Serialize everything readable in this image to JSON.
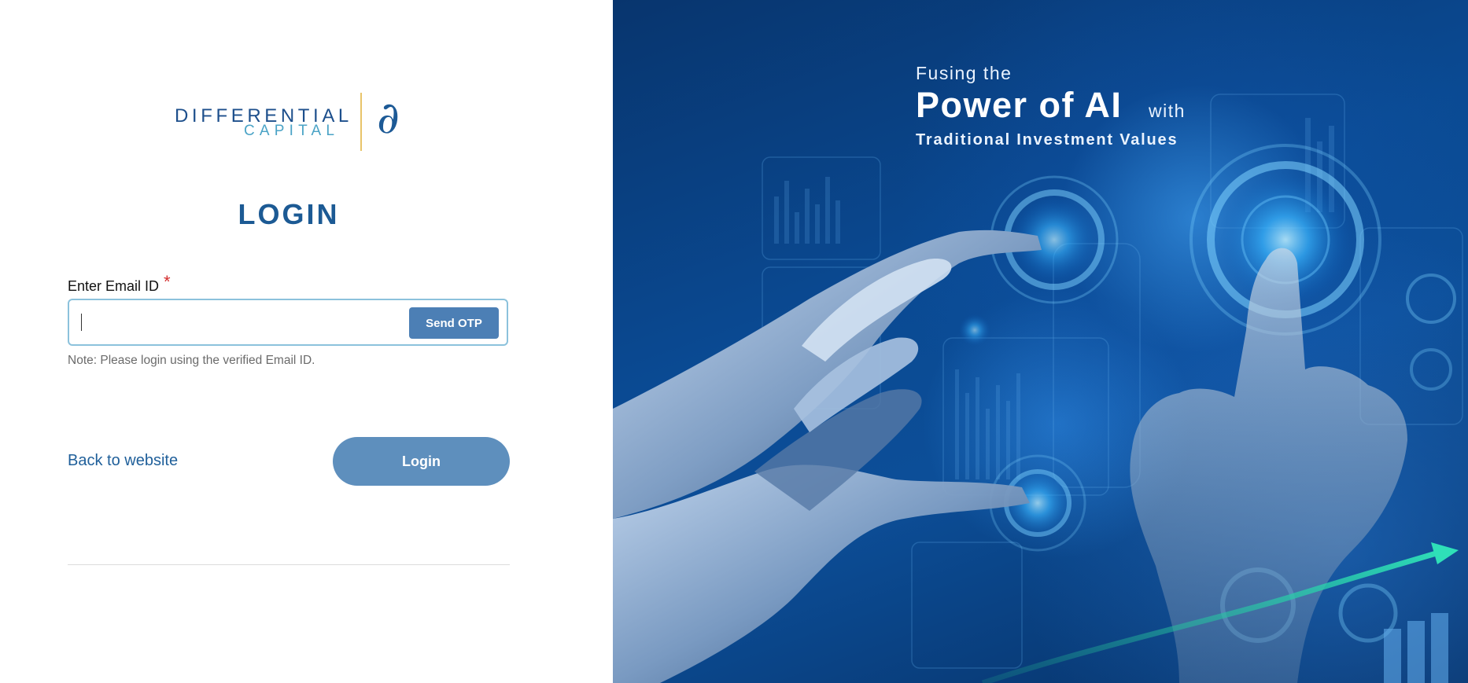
{
  "brand": {
    "name_line1": "DIFFERENTIAL",
    "name_line2": "CAPITAL",
    "mark": "∂",
    "colors": {
      "primary": "#1d4f8c",
      "secondary": "#4aa3c6",
      "gold": "#e8c46a"
    }
  },
  "login": {
    "title": "LOGIN",
    "email_label": "Enter Email ID",
    "required_marker": "*",
    "email_value": "",
    "email_placeholder": "",
    "send_otp_label": "Send OTP",
    "note": "Note: Please login using the verified Email ID.",
    "back_link_label": "Back to website",
    "login_button_label": "Login"
  },
  "hero": {
    "line1": "Fusing the",
    "line2": "Power of AI",
    "line2_suffix": "with",
    "line3": "Traditional Investment Values"
  },
  "colors": {
    "accent": "#1c5a94",
    "button": "#4c7fb5",
    "login_button": "#5e8fbd",
    "required": "#d32f2f",
    "input_border": "#8cc2dc"
  }
}
